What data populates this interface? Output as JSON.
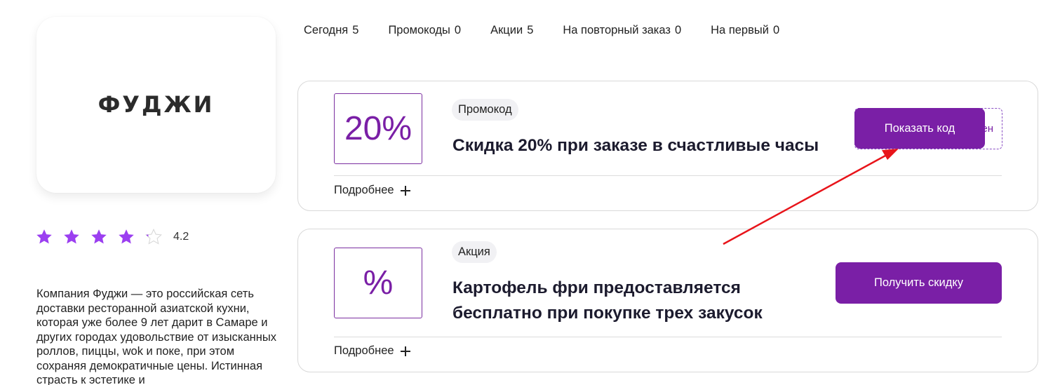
{
  "brand": {
    "logo_text": "ФУДЖИ"
  },
  "rating": {
    "value": "4.2",
    "stars": 4.2,
    "max": 5,
    "star_color": "#9b3ff0"
  },
  "description": "Компания Фуджи — это российская сеть доставки ресторанной азиатской кухни, которая уже более 9 лет дарит в Самаре и других городах удовольствие от изысканных роллов, пиццы, wok и поке, при этом сохраняя демократичные цены. Истинная страсть к эстетике и",
  "tabs": [
    {
      "label": "Сегодня",
      "count": "5"
    },
    {
      "label": "Промокоды",
      "count": "0"
    },
    {
      "label": "Акции",
      "count": "5"
    },
    {
      "label": "На повторный заказ",
      "count": "0"
    },
    {
      "label": "На первый",
      "count": "0"
    }
  ],
  "offers": [
    {
      "badge": "20%",
      "tag": "Промокод",
      "title": "Скидка 20% при заказе в счастливые часы",
      "more_label": "Подробнее",
      "code_peek": "ен",
      "button_label": "Показать код"
    },
    {
      "badge": "%",
      "tag": "Акция",
      "title": "Картофель фри предоставляется бесплатно при покупке трех закусок",
      "more_label": "Подробнее",
      "button_label": "Получить скидку"
    }
  ],
  "colors": {
    "accent": "#7a1fa6",
    "annotation_arrow": "#e8141a"
  },
  "icons": {
    "star": "star-icon",
    "plus": "plus-icon"
  }
}
